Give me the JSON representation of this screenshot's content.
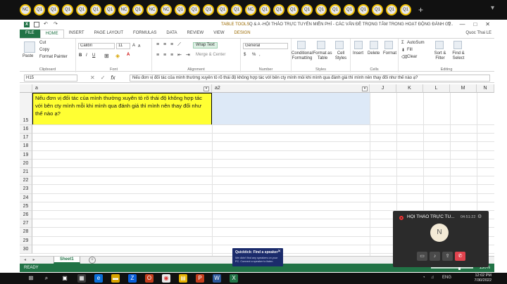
{
  "browser": {
    "tab_dots": [
      "NC",
      "Q1",
      "Q1",
      "Q1",
      "Q1",
      "Q1",
      "Q1",
      "NC",
      "Q1",
      "NC",
      "NC",
      "Q1",
      "Q1",
      "Q1",
      "Q1",
      "Q1",
      "NC",
      "Q1",
      "Q1",
      "Q1",
      "Q1",
      "Q1",
      "Q1",
      "Q1",
      "Q1",
      "Q1",
      "Q1",
      "Q1"
    ],
    "new_tab": "+"
  },
  "titlebar": {
    "contextual_label": "TABLE TOOLS",
    "document_title": "Q & A -HỘI THẢO TRỰC TUYẾN MIỄN PHÍ - CÁC VẤN ĐỀ TRỌNG TÂM TRONG HOẠT ĐỘNG ĐÁNH GI...",
    "help": "?",
    "minimize": "—",
    "maximize": "□",
    "close": "✕"
  },
  "ribbon_tabs": {
    "file": "FILE",
    "home": "HOME",
    "insert": "INSERT",
    "page_layout": "PAGE LAYOUT",
    "formulas": "FORMULAS",
    "data": "DATA",
    "review": "REVIEW",
    "view": "VIEW",
    "design": "DESIGN",
    "user": "Quoc Thai LE"
  },
  "ribbon": {
    "clipboard": {
      "paste": "Paste",
      "cut": "Cut",
      "copy": "Copy",
      "format_painter": "Format Painter",
      "label": "Clipboard"
    },
    "font": {
      "name": "Calibri",
      "size": "11",
      "bold": "B",
      "italic": "I",
      "underline": "U",
      "label": "Font",
      "grow": "A",
      "shrink": "A"
    },
    "alignment": {
      "wrap_text": "Wrap Text",
      "merge_center": "Merge & Center",
      "label": "Alignment"
    },
    "number": {
      "format": "General",
      "currency": "$",
      "percent": "%",
      "comma": ",",
      "label": "Number"
    },
    "styles": {
      "conditional": "Conditional Formatting",
      "format_table": "Format as Table",
      "cell_styles": "Cell Styles",
      "label": "Styles"
    },
    "cells": {
      "insert": "Insert",
      "delete": "Delete",
      "format": "Format",
      "label": "Cells"
    },
    "editing": {
      "autosum": "AutoSum",
      "fill": "Fill",
      "clear": "Clear",
      "sort": "Sort & Filter",
      "find": "Find & Select",
      "label": "Editing"
    }
  },
  "formula_bar": {
    "name_box": "H15",
    "cancel": "✕",
    "enter": "✓",
    "fx": "fx",
    "content": "Nếu đơn vị đối tác của mình thường xuyên tỏ rõ thái độ không hợp tác với bên cty mình mỗi khi mình qua đánh giá thì mình nên thay đổi như thế nào ạ?"
  },
  "grid": {
    "headers": {
      "a": "a",
      "a2": "a2",
      "J": "J",
      "K": "K",
      "L": "L",
      "M": "M",
      "N": "N"
    },
    "rows": [
      "15",
      "16",
      "17",
      "18",
      "19",
      "20",
      "21",
      "22",
      "23",
      "24",
      "25",
      "26",
      "27",
      "28",
      "29",
      "30"
    ],
    "cell_a15": "Nếu đơn vị đối tác của mình thường xuyên tỏ rõ thái độ không hợp tác với bên cty mình mỗi khi mình qua đánh giá thì mình nên thay đổi như thế nào ạ?"
  },
  "sheets": {
    "tab": "Sheet1",
    "add": "+",
    "nav": "◂ ▸"
  },
  "status": {
    "ready": "READY",
    "zoom": "130%"
  },
  "meeting": {
    "title": "HỘI THẢO TRỰC TU...",
    "time": "04:51:22",
    "avatar": "N",
    "gear": "⚙"
  },
  "toast": {
    "title": "Quicktick: Find a speaker",
    "body": "We didn't find any speakers on your PC. Connect a speaker to listen."
  },
  "tray": {
    "lang": "ENG",
    "time": "12:02 PM",
    "date": "7/30/2022"
  },
  "colors": {
    "excel_green": "#217346",
    "selected_cell": "#ffff33",
    "table_fill": "#dde9f7",
    "end_call": "#e0434e"
  }
}
